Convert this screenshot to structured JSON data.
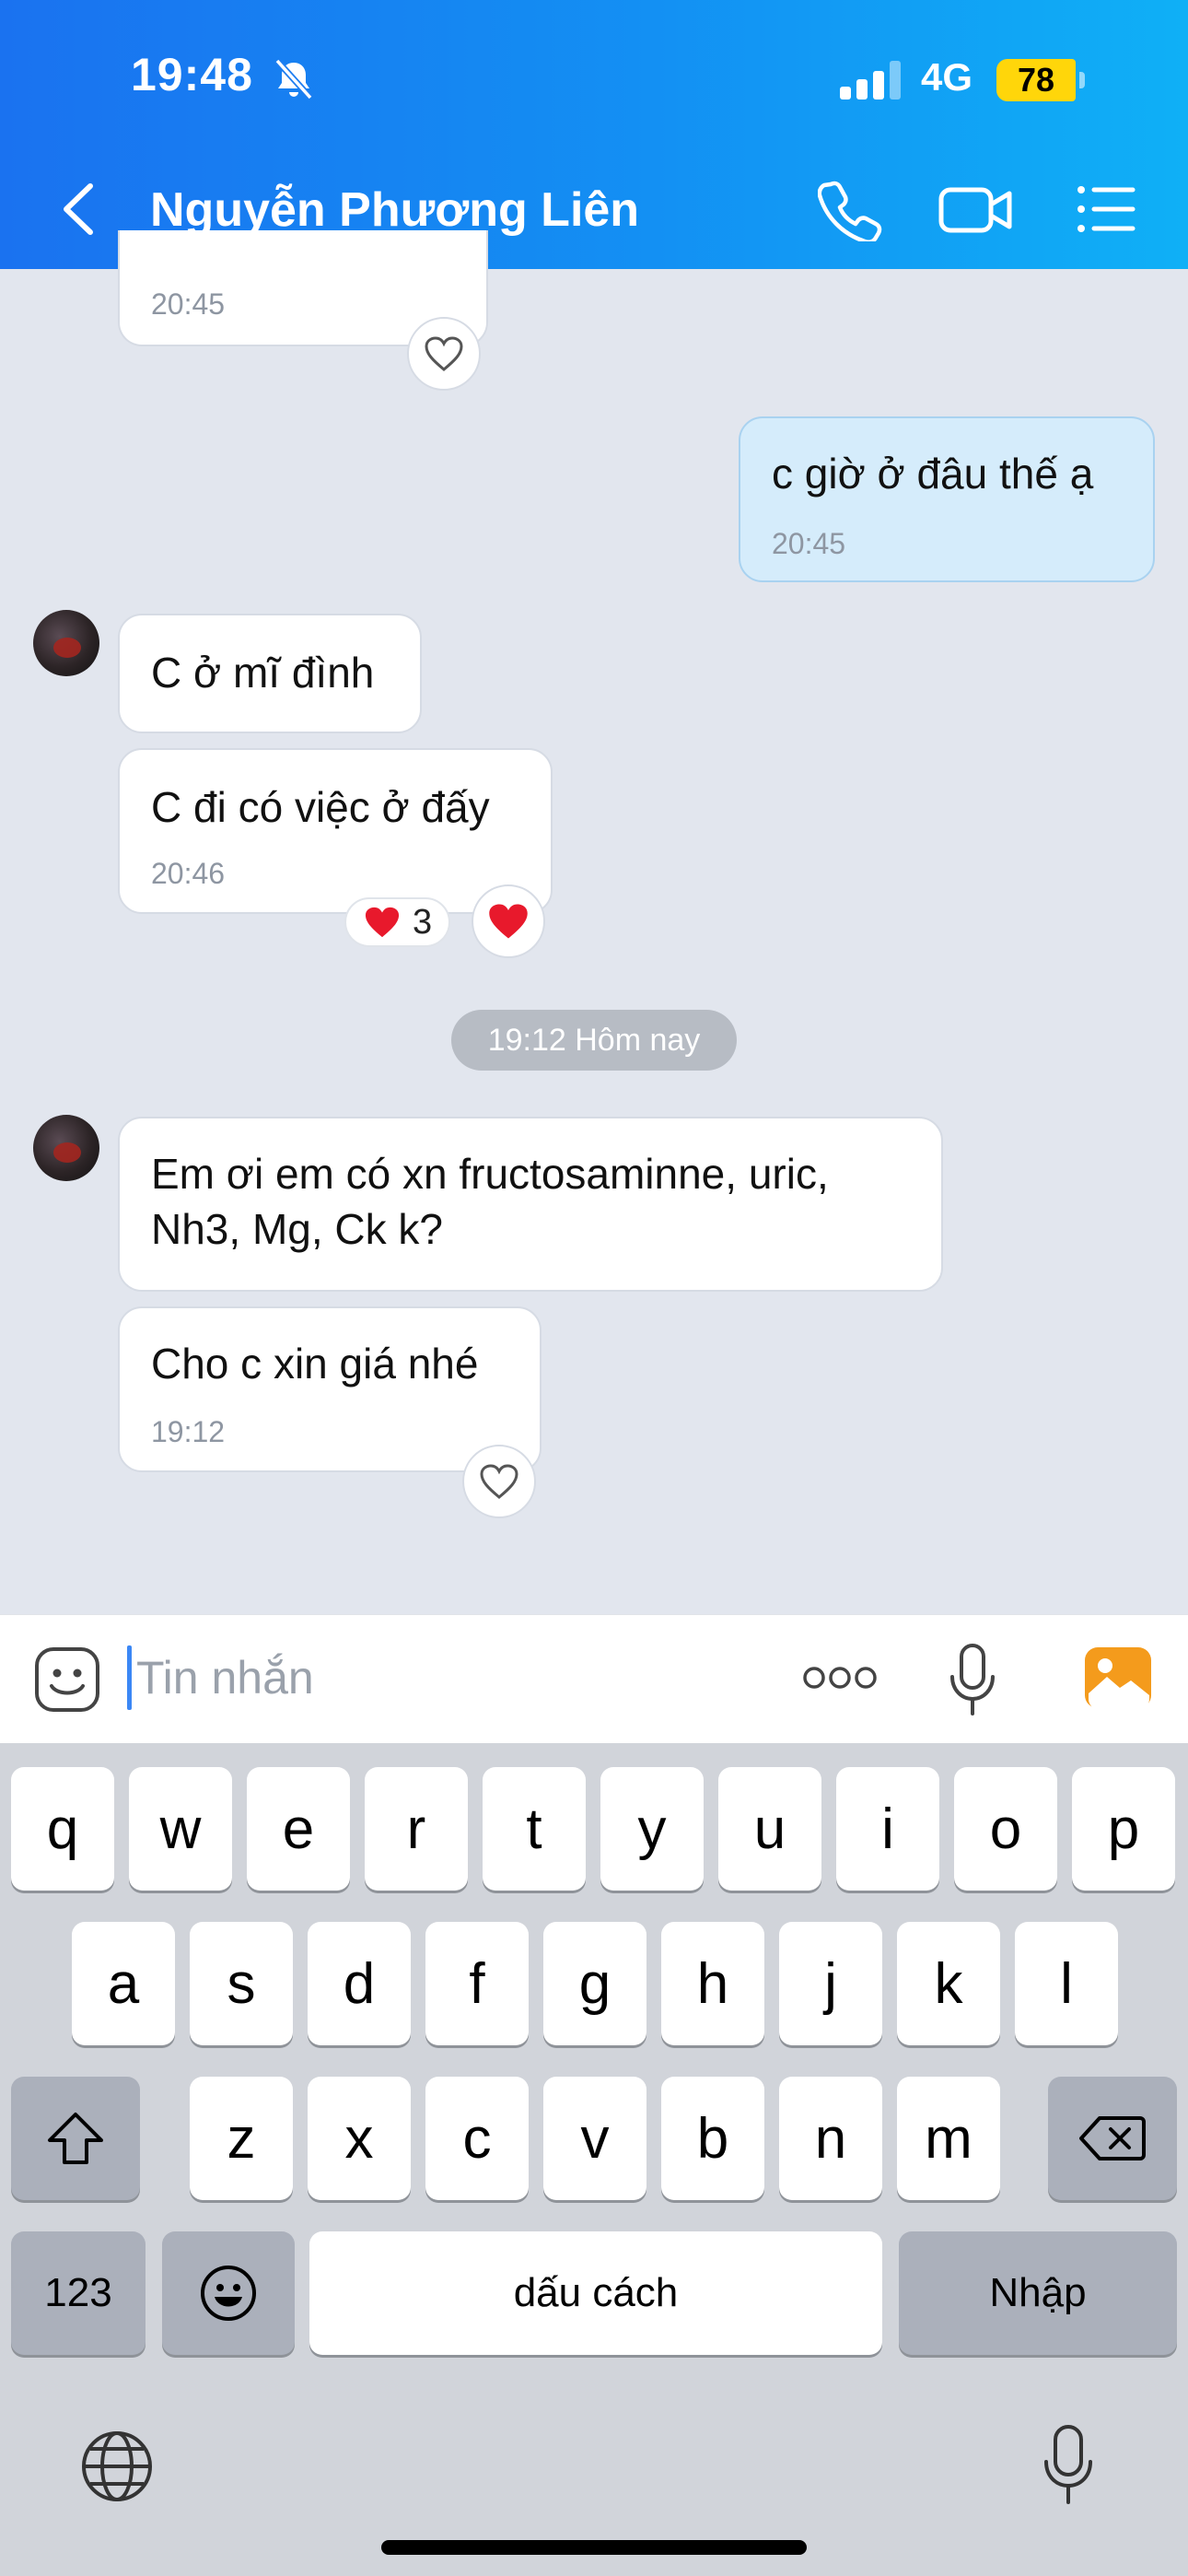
{
  "status_bar": {
    "time": "19:48",
    "network": "4G",
    "battery": "78"
  },
  "header": {
    "contact_name": "Nguyễn Phương Liên"
  },
  "messages": [
    {
      "time": "20:45"
    },
    {
      "text": "c giờ ở đâu thế ạ",
      "time": "20:45"
    },
    {
      "text": "C ở mĩ đình"
    },
    {
      "text": "C đi có việc ở đấy",
      "time": "20:46",
      "reaction_count": "3"
    },
    {
      "text": "Em ơi em có xn fructosaminne, uric,\nNh3, Mg, Ck k?"
    },
    {
      "text": "Cho c xin giá nhé",
      "time": "19:12"
    }
  ],
  "date_separator": "19:12 Hôm nay",
  "input": {
    "placeholder": "Tin nhắn"
  },
  "keyboard": {
    "row1": [
      "q",
      "w",
      "e",
      "r",
      "t",
      "y",
      "u",
      "i",
      "o",
      "p"
    ],
    "row2": [
      "a",
      "s",
      "d",
      "f",
      "g",
      "h",
      "j",
      "k",
      "l"
    ],
    "row3": [
      "z",
      "x",
      "c",
      "v",
      "b",
      "n",
      "m"
    ],
    "numbers_label": "123",
    "space_label": "dấu cách",
    "return_label": "Nhập"
  },
  "colors": {
    "header_start": "#1a72f0",
    "header_end": "#0fb0f6",
    "own_bubble": "#d5ecfb",
    "chat_background": "#e2e6ee",
    "reaction_heart": "#e8192c"
  },
  "icons": [
    "bell-off-icon",
    "signal-icon",
    "back-chevron-icon",
    "phone-icon",
    "video-icon",
    "menu-list-icon",
    "heart-outline-icon",
    "heart-filled-icon",
    "sticker-icon",
    "more-icon",
    "mic-icon",
    "image-icon",
    "shift-icon",
    "backspace-icon",
    "emoji-icon",
    "globe-icon",
    "dictation-icon"
  ]
}
